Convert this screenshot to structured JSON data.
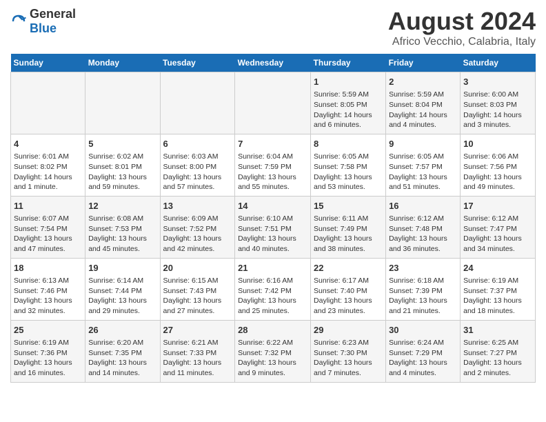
{
  "logo": {
    "general": "General",
    "blue": "Blue"
  },
  "title": "August 2024",
  "subtitle": "Africo Vecchio, Calabria, Italy",
  "days_of_week": [
    "Sunday",
    "Monday",
    "Tuesday",
    "Wednesday",
    "Thursday",
    "Friday",
    "Saturday"
  ],
  "weeks": [
    [
      {
        "day": "",
        "info": ""
      },
      {
        "day": "",
        "info": ""
      },
      {
        "day": "",
        "info": ""
      },
      {
        "day": "",
        "info": ""
      },
      {
        "day": "1",
        "info": "Sunrise: 5:59 AM\nSunset: 8:05 PM\nDaylight: 14 hours and 6 minutes."
      },
      {
        "day": "2",
        "info": "Sunrise: 5:59 AM\nSunset: 8:04 PM\nDaylight: 14 hours and 4 minutes."
      },
      {
        "day": "3",
        "info": "Sunrise: 6:00 AM\nSunset: 8:03 PM\nDaylight: 14 hours and 3 minutes."
      }
    ],
    [
      {
        "day": "4",
        "info": "Sunrise: 6:01 AM\nSunset: 8:02 PM\nDaylight: 14 hours and 1 minute."
      },
      {
        "day": "5",
        "info": "Sunrise: 6:02 AM\nSunset: 8:01 PM\nDaylight: 13 hours and 59 minutes."
      },
      {
        "day": "6",
        "info": "Sunrise: 6:03 AM\nSunset: 8:00 PM\nDaylight: 13 hours and 57 minutes."
      },
      {
        "day": "7",
        "info": "Sunrise: 6:04 AM\nSunset: 7:59 PM\nDaylight: 13 hours and 55 minutes."
      },
      {
        "day": "8",
        "info": "Sunrise: 6:05 AM\nSunset: 7:58 PM\nDaylight: 13 hours and 53 minutes."
      },
      {
        "day": "9",
        "info": "Sunrise: 6:05 AM\nSunset: 7:57 PM\nDaylight: 13 hours and 51 minutes."
      },
      {
        "day": "10",
        "info": "Sunrise: 6:06 AM\nSunset: 7:56 PM\nDaylight: 13 hours and 49 minutes."
      }
    ],
    [
      {
        "day": "11",
        "info": "Sunrise: 6:07 AM\nSunset: 7:54 PM\nDaylight: 13 hours and 47 minutes."
      },
      {
        "day": "12",
        "info": "Sunrise: 6:08 AM\nSunset: 7:53 PM\nDaylight: 13 hours and 45 minutes."
      },
      {
        "day": "13",
        "info": "Sunrise: 6:09 AM\nSunset: 7:52 PM\nDaylight: 13 hours and 42 minutes."
      },
      {
        "day": "14",
        "info": "Sunrise: 6:10 AM\nSunset: 7:51 PM\nDaylight: 13 hours and 40 minutes."
      },
      {
        "day": "15",
        "info": "Sunrise: 6:11 AM\nSunset: 7:49 PM\nDaylight: 13 hours and 38 minutes."
      },
      {
        "day": "16",
        "info": "Sunrise: 6:12 AM\nSunset: 7:48 PM\nDaylight: 13 hours and 36 minutes."
      },
      {
        "day": "17",
        "info": "Sunrise: 6:12 AM\nSunset: 7:47 PM\nDaylight: 13 hours and 34 minutes."
      }
    ],
    [
      {
        "day": "18",
        "info": "Sunrise: 6:13 AM\nSunset: 7:46 PM\nDaylight: 13 hours and 32 minutes."
      },
      {
        "day": "19",
        "info": "Sunrise: 6:14 AM\nSunset: 7:44 PM\nDaylight: 13 hours and 29 minutes."
      },
      {
        "day": "20",
        "info": "Sunrise: 6:15 AM\nSunset: 7:43 PM\nDaylight: 13 hours and 27 minutes."
      },
      {
        "day": "21",
        "info": "Sunrise: 6:16 AM\nSunset: 7:42 PM\nDaylight: 13 hours and 25 minutes."
      },
      {
        "day": "22",
        "info": "Sunrise: 6:17 AM\nSunset: 7:40 PM\nDaylight: 13 hours and 23 minutes."
      },
      {
        "day": "23",
        "info": "Sunrise: 6:18 AM\nSunset: 7:39 PM\nDaylight: 13 hours and 21 minutes."
      },
      {
        "day": "24",
        "info": "Sunrise: 6:19 AM\nSunset: 7:37 PM\nDaylight: 13 hours and 18 minutes."
      }
    ],
    [
      {
        "day": "25",
        "info": "Sunrise: 6:19 AM\nSunset: 7:36 PM\nDaylight: 13 hours and 16 minutes."
      },
      {
        "day": "26",
        "info": "Sunrise: 6:20 AM\nSunset: 7:35 PM\nDaylight: 13 hours and 14 minutes."
      },
      {
        "day": "27",
        "info": "Sunrise: 6:21 AM\nSunset: 7:33 PM\nDaylight: 13 hours and 11 minutes."
      },
      {
        "day": "28",
        "info": "Sunrise: 6:22 AM\nSunset: 7:32 PM\nDaylight: 13 hours and 9 minutes."
      },
      {
        "day": "29",
        "info": "Sunrise: 6:23 AM\nSunset: 7:30 PM\nDaylight: 13 hours and 7 minutes."
      },
      {
        "day": "30",
        "info": "Sunrise: 6:24 AM\nSunset: 7:29 PM\nDaylight: 13 hours and 4 minutes."
      },
      {
        "day": "31",
        "info": "Sunrise: 6:25 AM\nSunset: 7:27 PM\nDaylight: 13 hours and 2 minutes."
      }
    ]
  ]
}
